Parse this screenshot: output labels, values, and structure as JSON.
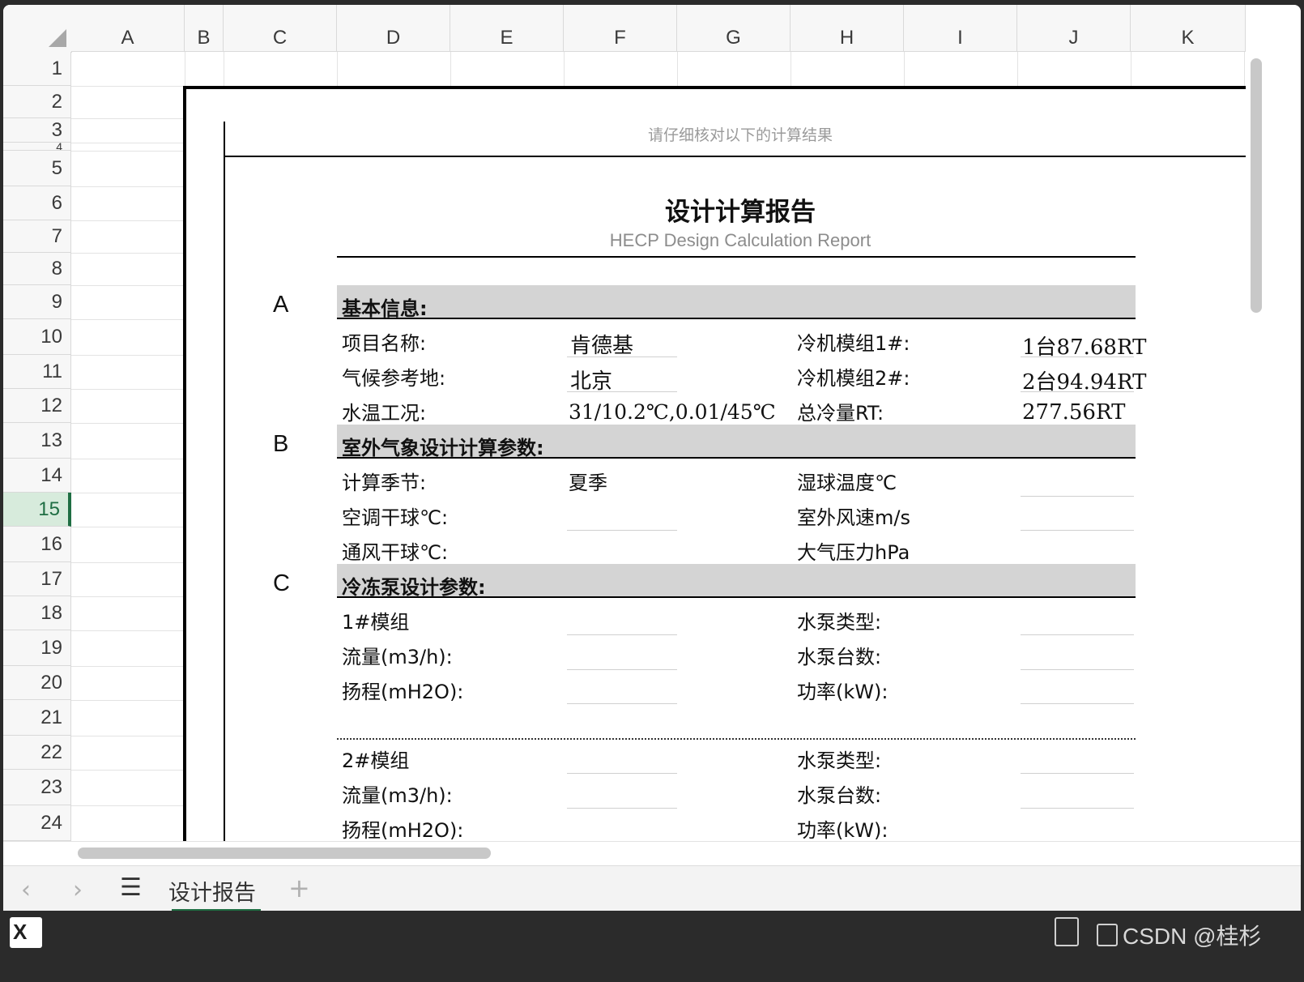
{
  "columns": [
    "A",
    "B",
    "C",
    "D",
    "E",
    "F",
    "G",
    "H",
    "I",
    "J",
    "K"
  ],
  "rows": [
    "1",
    "2",
    "3",
    "4",
    "5",
    "6",
    "7",
    "8",
    "9",
    "10",
    "11",
    "12",
    "13",
    "14",
    "15",
    "16",
    "17",
    "18",
    "19",
    "20",
    "21",
    "22",
    "23",
    "24"
  ],
  "selected_row": "15",
  "report": {
    "hint": "请仔细核对以下的计算结果",
    "title": "设计计算报告",
    "subtitle": "HECP Design Calculation Report",
    "sections": {
      "a": {
        "letter": "A",
        "title": "基本信息:",
        "project_label": "项目名称:",
        "project_value": "肯德基",
        "climate_label": "气候参考地:",
        "climate_value": "北京",
        "water_label": "水温工况:",
        "water_value": "31/10.2℃,0.01/45℃",
        "chiller1_label": "冷机模组1#:",
        "chiller1_value": "1台87.68RT",
        "chiller2_label": "冷机模组2#:",
        "chiller2_value": "2台94.94RT",
        "total_label": "总冷量RT:",
        "total_value": "277.56RT"
      },
      "b": {
        "letter": "B",
        "title": "室外气象设计计算参数:",
        "season_label": "计算季节:",
        "season_value": "夏季",
        "ac_dry_label": "空调干球℃:",
        "vent_dry_label": "通风干球℃:",
        "wet_bulb_label": "湿球温度℃",
        "wind_label": "室外风速m/s",
        "pressure_label": "大气压力hPa"
      },
      "c": {
        "letter": "C",
        "title": "冷冻泵设计参数:",
        "m1_label": "1#模组",
        "m1_flow": "流量(m3/h):",
        "m1_head": "扬程(mH2O):",
        "m1_type": "水泵类型:",
        "m1_count": "水泵台数:",
        "m1_power": "功率(kW):",
        "m2_label": "2#模组",
        "m2_flow": "流量(m3/h):",
        "m2_head": "扬程(mH2O):",
        "m2_type": "水泵类型:",
        "m2_count": "水泵台数:",
        "m2_power": "功率(kW):"
      }
    }
  },
  "sheet_tab": "设计报告",
  "watermark": "CSDN @桂杉",
  "icons": {
    "prev": "chevron-left-icon",
    "next": "chevron-right-icon",
    "menu": "hamburger-icon",
    "add": "plus-icon",
    "app": "excel-icon"
  },
  "colors": {
    "accent": "#1f6e43",
    "section_bg": "#d4d4d4",
    "selected_row_bg": "#d7ebdc"
  }
}
